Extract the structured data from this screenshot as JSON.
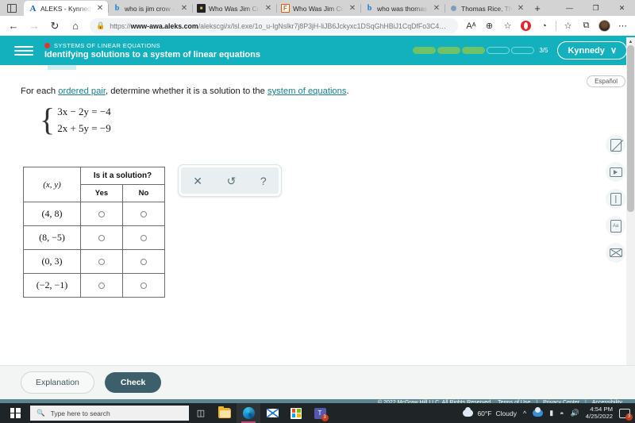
{
  "browser": {
    "tabs": [
      {
        "title": "ALEKS - Kynnedy C",
        "favicon": "aleks-icon",
        "active": true
      },
      {
        "title": "who is jim crow - S",
        "favicon": "bing-icon",
        "active": false
      },
      {
        "title": "Who Was Jim Crow",
        "favicon": "history-icon",
        "active": false
      },
      {
        "title": "Who Was Jim Crow",
        "favicon": "ferris-icon",
        "active": false
      },
      {
        "title": "who was thomas d",
        "favicon": "bing-icon",
        "active": false
      },
      {
        "title": "Thomas Rice, The F",
        "favicon": "generic-icon",
        "active": false
      }
    ],
    "new_tab_label": "+",
    "window_controls": {
      "minimize": "—",
      "maximize": "❐",
      "close": "✕"
    },
    "nav": {
      "back": "←",
      "forward": "→",
      "reload": "↻",
      "home": "⌂"
    },
    "url_prefix": "https://",
    "url_domain": "www-awa.aleks.com",
    "url_path": "/alekscgi/x/lsl.exe/1o_u-IgNslkr7j8P3jH-liJB6Jckyxc1DSqGhHBiJ1CqDfFo3C4…",
    "toolbar_icons": {
      "read_aloud": "Aᴬ",
      "zoom": "⊕",
      "favorite": "☆",
      "opera": "O",
      "essentials": "◔",
      "collections": "⧉",
      "favorites_bar": "☆",
      "more": "⋯"
    }
  },
  "aleks_header": {
    "kicker": "SYSTEMS OF LINEAR EQUATIONS",
    "title": "Identifying solutions to a system of linear equations",
    "progress": {
      "total_segments": 5,
      "completed_segments": 3,
      "label": "3/5"
    },
    "user_name": "Kynnedy",
    "chevron": "∨"
  },
  "content": {
    "espanol_label": "Español",
    "prompt": {
      "part1": "For each ",
      "link1": "ordered pair",
      "part2": ", determine whether it is a solution to the ",
      "link2": "system of equations",
      "part3": "."
    },
    "equations": [
      "3x − 2y = −4",
      "2x + 5y = −9"
    ],
    "table": {
      "header_span": "Is it a solution?",
      "col_xy": "(x, y)",
      "col_yes": "Yes",
      "col_no": "No",
      "rows": [
        {
          "pair": "(4, 8)",
          "yes_selected": false,
          "no_selected": false
        },
        {
          "pair": "(8, −5)",
          "yes_selected": false,
          "no_selected": false
        },
        {
          "pair": "(0, 3)",
          "yes_selected": false,
          "no_selected": false
        },
        {
          "pair": "(−2, −1)",
          "yes_selected": false,
          "no_selected": false
        }
      ]
    },
    "float_toolbar": {
      "clear": "✕",
      "undo": "↺",
      "help": "?"
    },
    "rail_icons": [
      "calculator-disabled-icon",
      "video-icon",
      "book-icon",
      "reading-icon",
      "mail-icon"
    ]
  },
  "footer": {
    "explanation_label": "Explanation",
    "check_label": "Check",
    "copyright": "© 2022 McGraw Hill LLC. All Rights Reserved.",
    "links": [
      "Terms of Use",
      "Privacy Center",
      "Accessibility"
    ],
    "separator": "|"
  },
  "taskbar": {
    "search_placeholder": "Type here to search",
    "items": [
      "task-view",
      "file-explorer",
      "edge",
      "mail",
      "microsoft-store",
      "teams"
    ],
    "teams_badge": "3",
    "weather_temp": "60°F",
    "weather_desc": "Cloudy",
    "time": "4:54 PM",
    "date": "4/25/2022",
    "notification_badge": "3"
  }
}
